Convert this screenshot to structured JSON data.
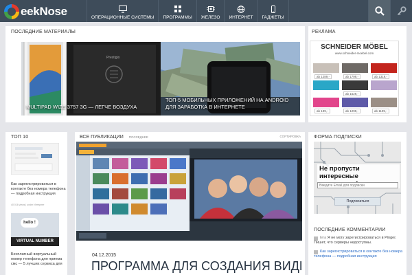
{
  "header": {
    "logo_text": "eekNose",
    "nav": [
      {
        "label": "Операционные системы",
        "icon": "monitor-icon"
      },
      {
        "label": "Программы",
        "icon": "apps-icon"
      },
      {
        "label": "Железо",
        "icon": "hardware-icon"
      },
      {
        "label": "Интернет",
        "icon": "globe-icon"
      },
      {
        "label": "Гаджеты",
        "icon": "phone-icon"
      }
    ]
  },
  "latest": {
    "title": "Последние материалы",
    "items": [
      {
        "caption": "Multipad Wize 3757 3G — легче воздуха"
      },
      {
        "caption": "ТОП-5 мобильных приложений на Android для заработка в интернете"
      }
    ]
  },
  "ads": {
    "title": "Реклама",
    "brand": "SCHNEIDER MÖBEL",
    "url": "www.schneider-moebel.com",
    "prices": [
      "ab 1289,-",
      "ab 1799,-",
      "ab 1319,-",
      "ab 1529,-",
      "ab 199,-",
      "ab 1299,-",
      "ab 1199,-"
    ]
  },
  "top10": {
    "title": "Топ 10",
    "items": [
      {
        "text": "Как зарегистрироваться в контакте без номера телефона — подробная инструкция",
        "meta": "40 016 views | under Интернет"
      },
      {
        "text": "Бесплатный виртуальный номер телефона для приема смс — 5 лучших сервиса для",
        "meta": "",
        "image_text_1": "hello !",
        "image_text_2": "VIRTUAL NUMBER"
      }
    ]
  },
  "feed": {
    "tab_main": "Все публикации",
    "tab_sub": "Последнее",
    "sort": "Сортировка",
    "date": "04.12.2015",
    "headline": "Программа для создания видео из фото с музыкой и надписями"
  },
  "subscribe": {
    "title": "Форма подписки",
    "text": "Не пропусти интересные материалы!",
    "placeholder": "Введите Email для подписки",
    "button": "Подписаться"
  },
  "comments": {
    "title": "Последние комментарии",
    "items": [
      {
        "author": "lera",
        "text": "Я не могу зарегистрироваться в Pinger. Пишет, что серверы недоступны.",
        "link": ""
      },
      {
        "author": "",
        "text": "",
        "link": "Как зарегистрироваться в контакте без номера телефона — подробная инструкция"
      }
    ]
  },
  "colors": {
    "topbar": "#3e4c5a",
    "page_bg": "#e5e6ea",
    "headline": "#263240",
    "link": "#2a6cc8"
  }
}
